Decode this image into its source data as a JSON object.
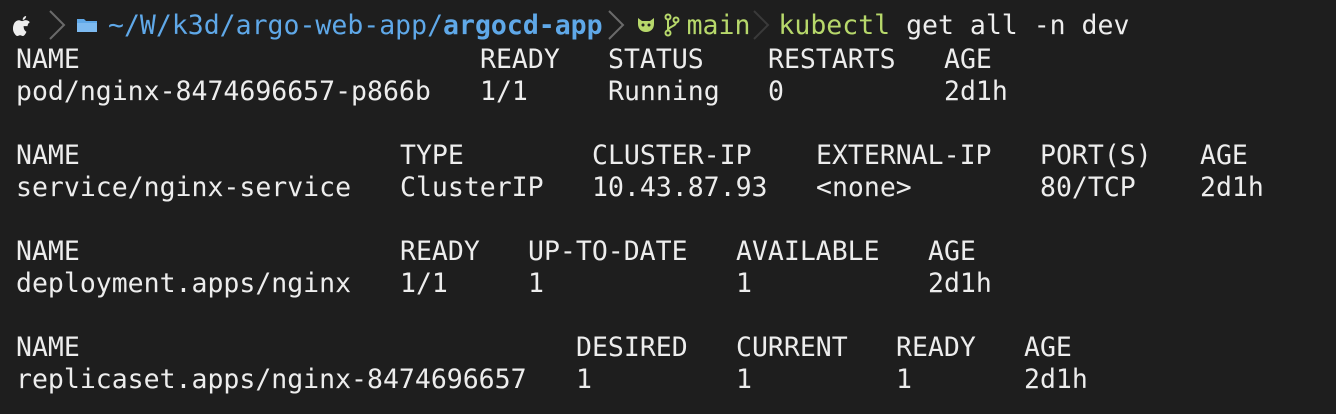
{
  "prompt": {
    "os_icon": "apple-logo-icon",
    "folder_icon": "folder-icon",
    "path_prefix": "~/W/k3d/argo-web-app/",
    "path_current": "argocd-app",
    "git_icon": "github-cat-icon",
    "branch_icon": "git-branch-icon",
    "branch": "main",
    "command": "kubectl",
    "args": " get all -n dev"
  },
  "colors": {
    "background": "#1e1e1e",
    "text": "#ededed",
    "path": "#5fa8e8",
    "git": "#b7d86b",
    "command": "#b7d86b"
  },
  "tables": {
    "pods": {
      "headers": [
        "NAME",
        "READY",
        "STATUS",
        "RESTARTS",
        "AGE"
      ],
      "rows": [
        [
          "pod/nginx-8474696657-p866b",
          "1/1",
          "Running",
          "0",
          "2d1h"
        ]
      ]
    },
    "services": {
      "headers": [
        "NAME",
        "TYPE",
        "CLUSTER-IP",
        "EXTERNAL-IP",
        "PORT(S)",
        "AGE"
      ],
      "rows": [
        [
          "service/nginx-service",
          "ClusterIP",
          "10.43.87.93",
          "<none>",
          "80/TCP",
          "2d1h"
        ]
      ]
    },
    "deployments": {
      "headers": [
        "NAME",
        "READY",
        "UP-TO-DATE",
        "AVAILABLE",
        "AGE"
      ],
      "rows": [
        [
          "deployment.apps/nginx",
          "1/1",
          "1",
          "1",
          "2d1h"
        ]
      ]
    },
    "replicasets": {
      "headers": [
        "NAME",
        "DESIRED",
        "CURRENT",
        "READY",
        "AGE"
      ],
      "rows": [
        [
          "replicaset.apps/nginx-8474696657",
          "1",
          "1",
          "1",
          "2d1h"
        ]
      ]
    }
  }
}
